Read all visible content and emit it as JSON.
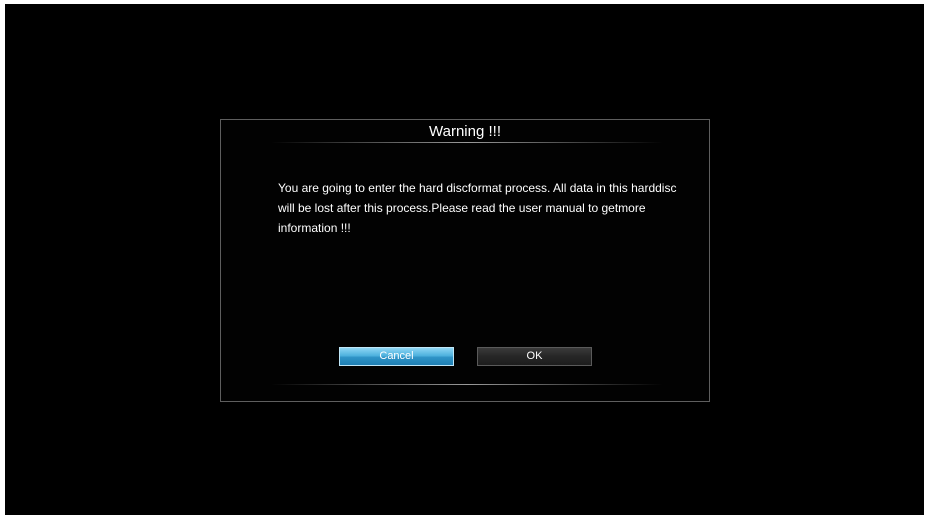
{
  "dialog": {
    "title": "Warning !!!",
    "message": "You are going to enter the hard discformat process. All data in this harddisc will be lost after this process.Please read the user manual to getmore information !!!",
    "buttons": {
      "cancel_label": "Cancel",
      "ok_label": "OK"
    },
    "selected_button": "cancel"
  },
  "colors": {
    "background": "#000000",
    "selected_button": "#4fb2de",
    "unselected_button": "#262626",
    "text": "#ffffff"
  }
}
